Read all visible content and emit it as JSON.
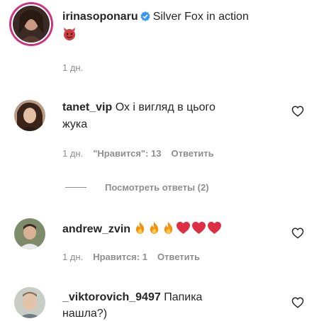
{
  "caption": {
    "username": "irinasoponaru",
    "text": "Silver Fox in action",
    "emoji": "devil-emoji",
    "time": "1 дн."
  },
  "comments": [
    {
      "username": "tanet_vip",
      "text_line1": "Ох і вигляд в цього",
      "text_line2": "жука",
      "time": "1 дн.",
      "likes": "\"Нравится\": 13",
      "reply_label": "Ответить"
    },
    {
      "username": "andrew_zvin",
      "emojis": [
        "fire",
        "fire",
        "fire",
        "red-heart",
        "red-heart",
        "red-heart"
      ],
      "time": "1 дн.",
      "likes": "Нравится: 1",
      "reply_label": "Ответить"
    },
    {
      "username": "_viktorovich_9497",
      "text_line1": "Папика",
      "text_line2": "нашла?)"
    }
  ],
  "view_replies": "Посмотреть ответы (2)",
  "colors": {
    "text": "#262626",
    "muted": "#8e8e8e",
    "verified": "#3897f0",
    "fire": "#f4900c",
    "heart": "#dd2e44"
  }
}
